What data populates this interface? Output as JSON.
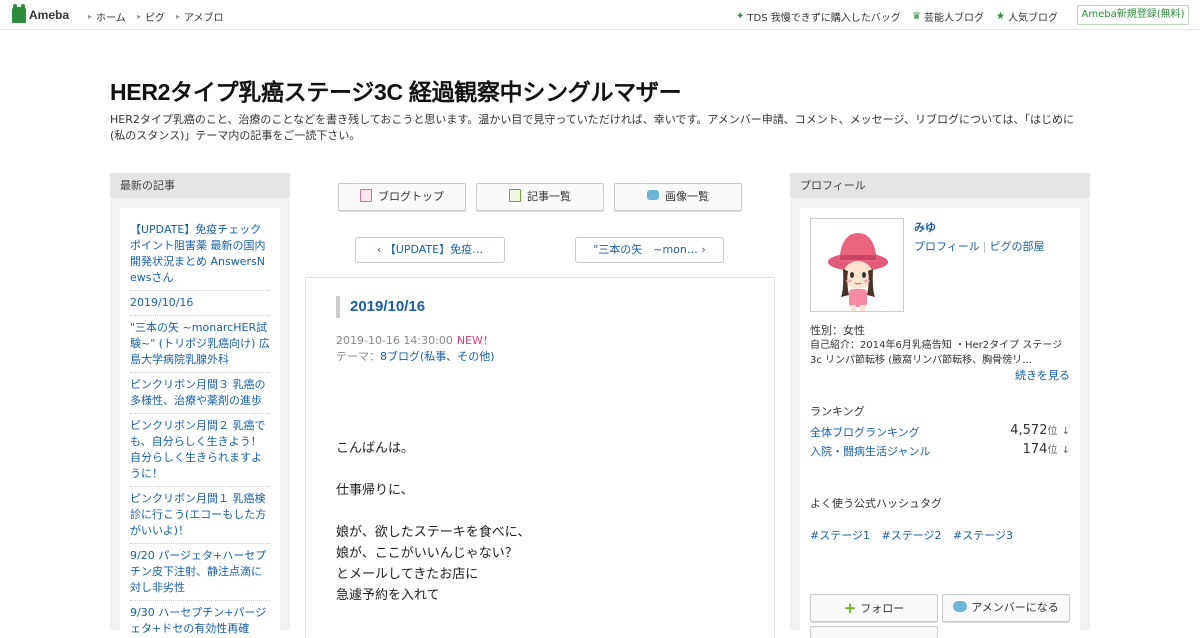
{
  "header": {
    "logo_text": "Ameba",
    "nav": [
      {
        "label": "ホーム"
      },
      {
        "label": "ピグ"
      },
      {
        "label": "アメブロ"
      }
    ],
    "right_links": [
      {
        "label": "TDS 我慢できずに購入したバッグ",
        "icon": "sparkle-icon"
      },
      {
        "label": "芸能人ブログ",
        "icon": "crown-icon"
      },
      {
        "label": "人気ブログ",
        "icon": "star-icon"
      }
    ],
    "register_label": "Ameba新規登録(無料)"
  },
  "blog": {
    "title": "HER2タイプ乳癌ステージ3C 経過観察中シングルマザー",
    "description": "HER2タイプ乳癌のこと、治療のことなどを書き残しておこうと思います。温かい目で見守っていただければ、幸いです。アメンバー申請、コメント、メッセージ、リブログについては、「はじめに(私のスタンス)」テーマ内の記事をご一読下さい。"
  },
  "left_sidebar": {
    "heading": "最新の記事",
    "items": [
      {
        "label": "【UPDATE】免疫チェックポイント阻害薬 最新の国内開発状況まとめ AnswersNewsさん"
      },
      {
        "label": "2019/10/16"
      },
      {
        "label": "\"三本の矢 ~monarcHER試験~\" (トリポジ乳癌向け) 広島大学病院乳腺外科"
      },
      {
        "label": "ピンクリボン月間３ 乳癌の多様性、治療や薬剤の進歩"
      },
      {
        "label": "ピンクリボン月間２ 乳癌でも、自分らしく生きよう！自分らしく生きられますように！"
      },
      {
        "label": "ピンクリボン月間１ 乳癌検診に行こう(エコーもした方がいいよ)！"
      },
      {
        "label": "9/20 パージェタ+ハーセプチン皮下注射、静注点滴に対し非劣性"
      },
      {
        "label": "9/30 ハーセプチン+パージェタ+ドセの有効性再確"
      }
    ]
  },
  "toolbar": {
    "blog_top": "ブログトップ",
    "article_list": "記事一覧",
    "image_list": "画像一覧"
  },
  "pager": {
    "prev": "【UPDATE】免疫…",
    "next": "\"三本の矢　~mon…"
  },
  "article": {
    "title": "2019/10/16",
    "datetime": "2019-10-16 14:30:00",
    "new_badge": "NEW！",
    "theme_prefix": "テーマ：",
    "theme": "8ブログ(私事、その他)",
    "body": [
      "こんばんは。",
      "",
      "仕事帰りに、",
      "",
      "娘が、欲したステーキを食べに、",
      "娘が、ここがいいんじゃない？",
      "とメールしてきたお店に",
      "急遽予約を入れて"
    ]
  },
  "profile": {
    "heading": "プロフィール",
    "name": "みゆ",
    "profile_link": "プロフィール",
    "pig_room_link": "ピグの部屋",
    "gender": "性別：女性",
    "intro": "自己紹介：2014年6月乳癌告知 ・Her2タイプ ステージ3c リンパ節転移 (腋窩リンパ節転移、胸骨傍リ…",
    "more": "続きを見る",
    "ranking_heading": "ランキング",
    "rankings": [
      {
        "label": "全体ブログランキング",
        "value": "4,572",
        "unit": "位",
        "trend": "↓"
      },
      {
        "label": "入院・闘病生活ジャンル",
        "value": "174",
        "unit": "位",
        "trend": "↓"
      }
    ],
    "hashtag_heading": "よく使う公式ハッシュタグ",
    "hashtags": [
      "#ステージ1",
      "#ステージ2",
      "#ステージ3"
    ],
    "follow_label": "フォロー",
    "amember_label": "アメンバーになる"
  },
  "colors": {
    "link": "#1a5fa8",
    "brand_green": "#2d8c3c",
    "new_badge": "#e0407a"
  }
}
